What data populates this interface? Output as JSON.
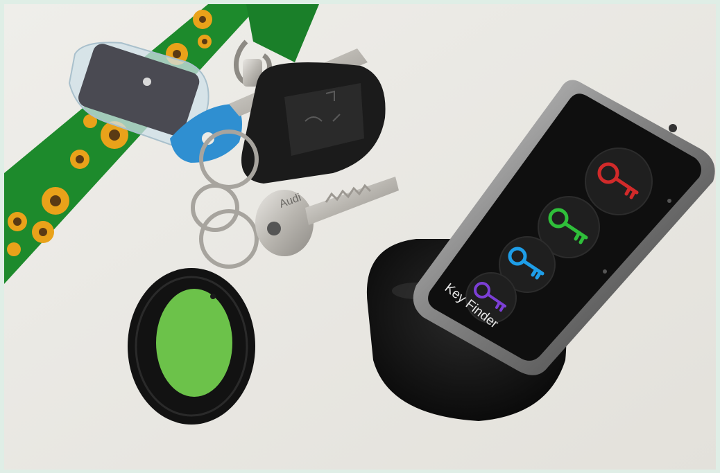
{
  "photo": {
    "subject": "keys-with-remote-key-finder",
    "remote_label": "Key Finder",
    "fob_text": "Audi",
    "buttons": [
      {
        "icon": "key-icon",
        "color": "#d12a2a"
      },
      {
        "icon": "key-icon",
        "color": "#2fbf3a"
      },
      {
        "icon": "key-icon",
        "color": "#1e9ee8"
      },
      {
        "icon": "key-icon",
        "color": "#7c3fd6"
      }
    ],
    "colors": {
      "frame": "#dfeee6",
      "surface": "#ecebe6",
      "lanyard": "#1d8a2c",
      "sunflower": "#e9a21a",
      "tag_green": "#6cc24a",
      "device": "#141414"
    }
  }
}
